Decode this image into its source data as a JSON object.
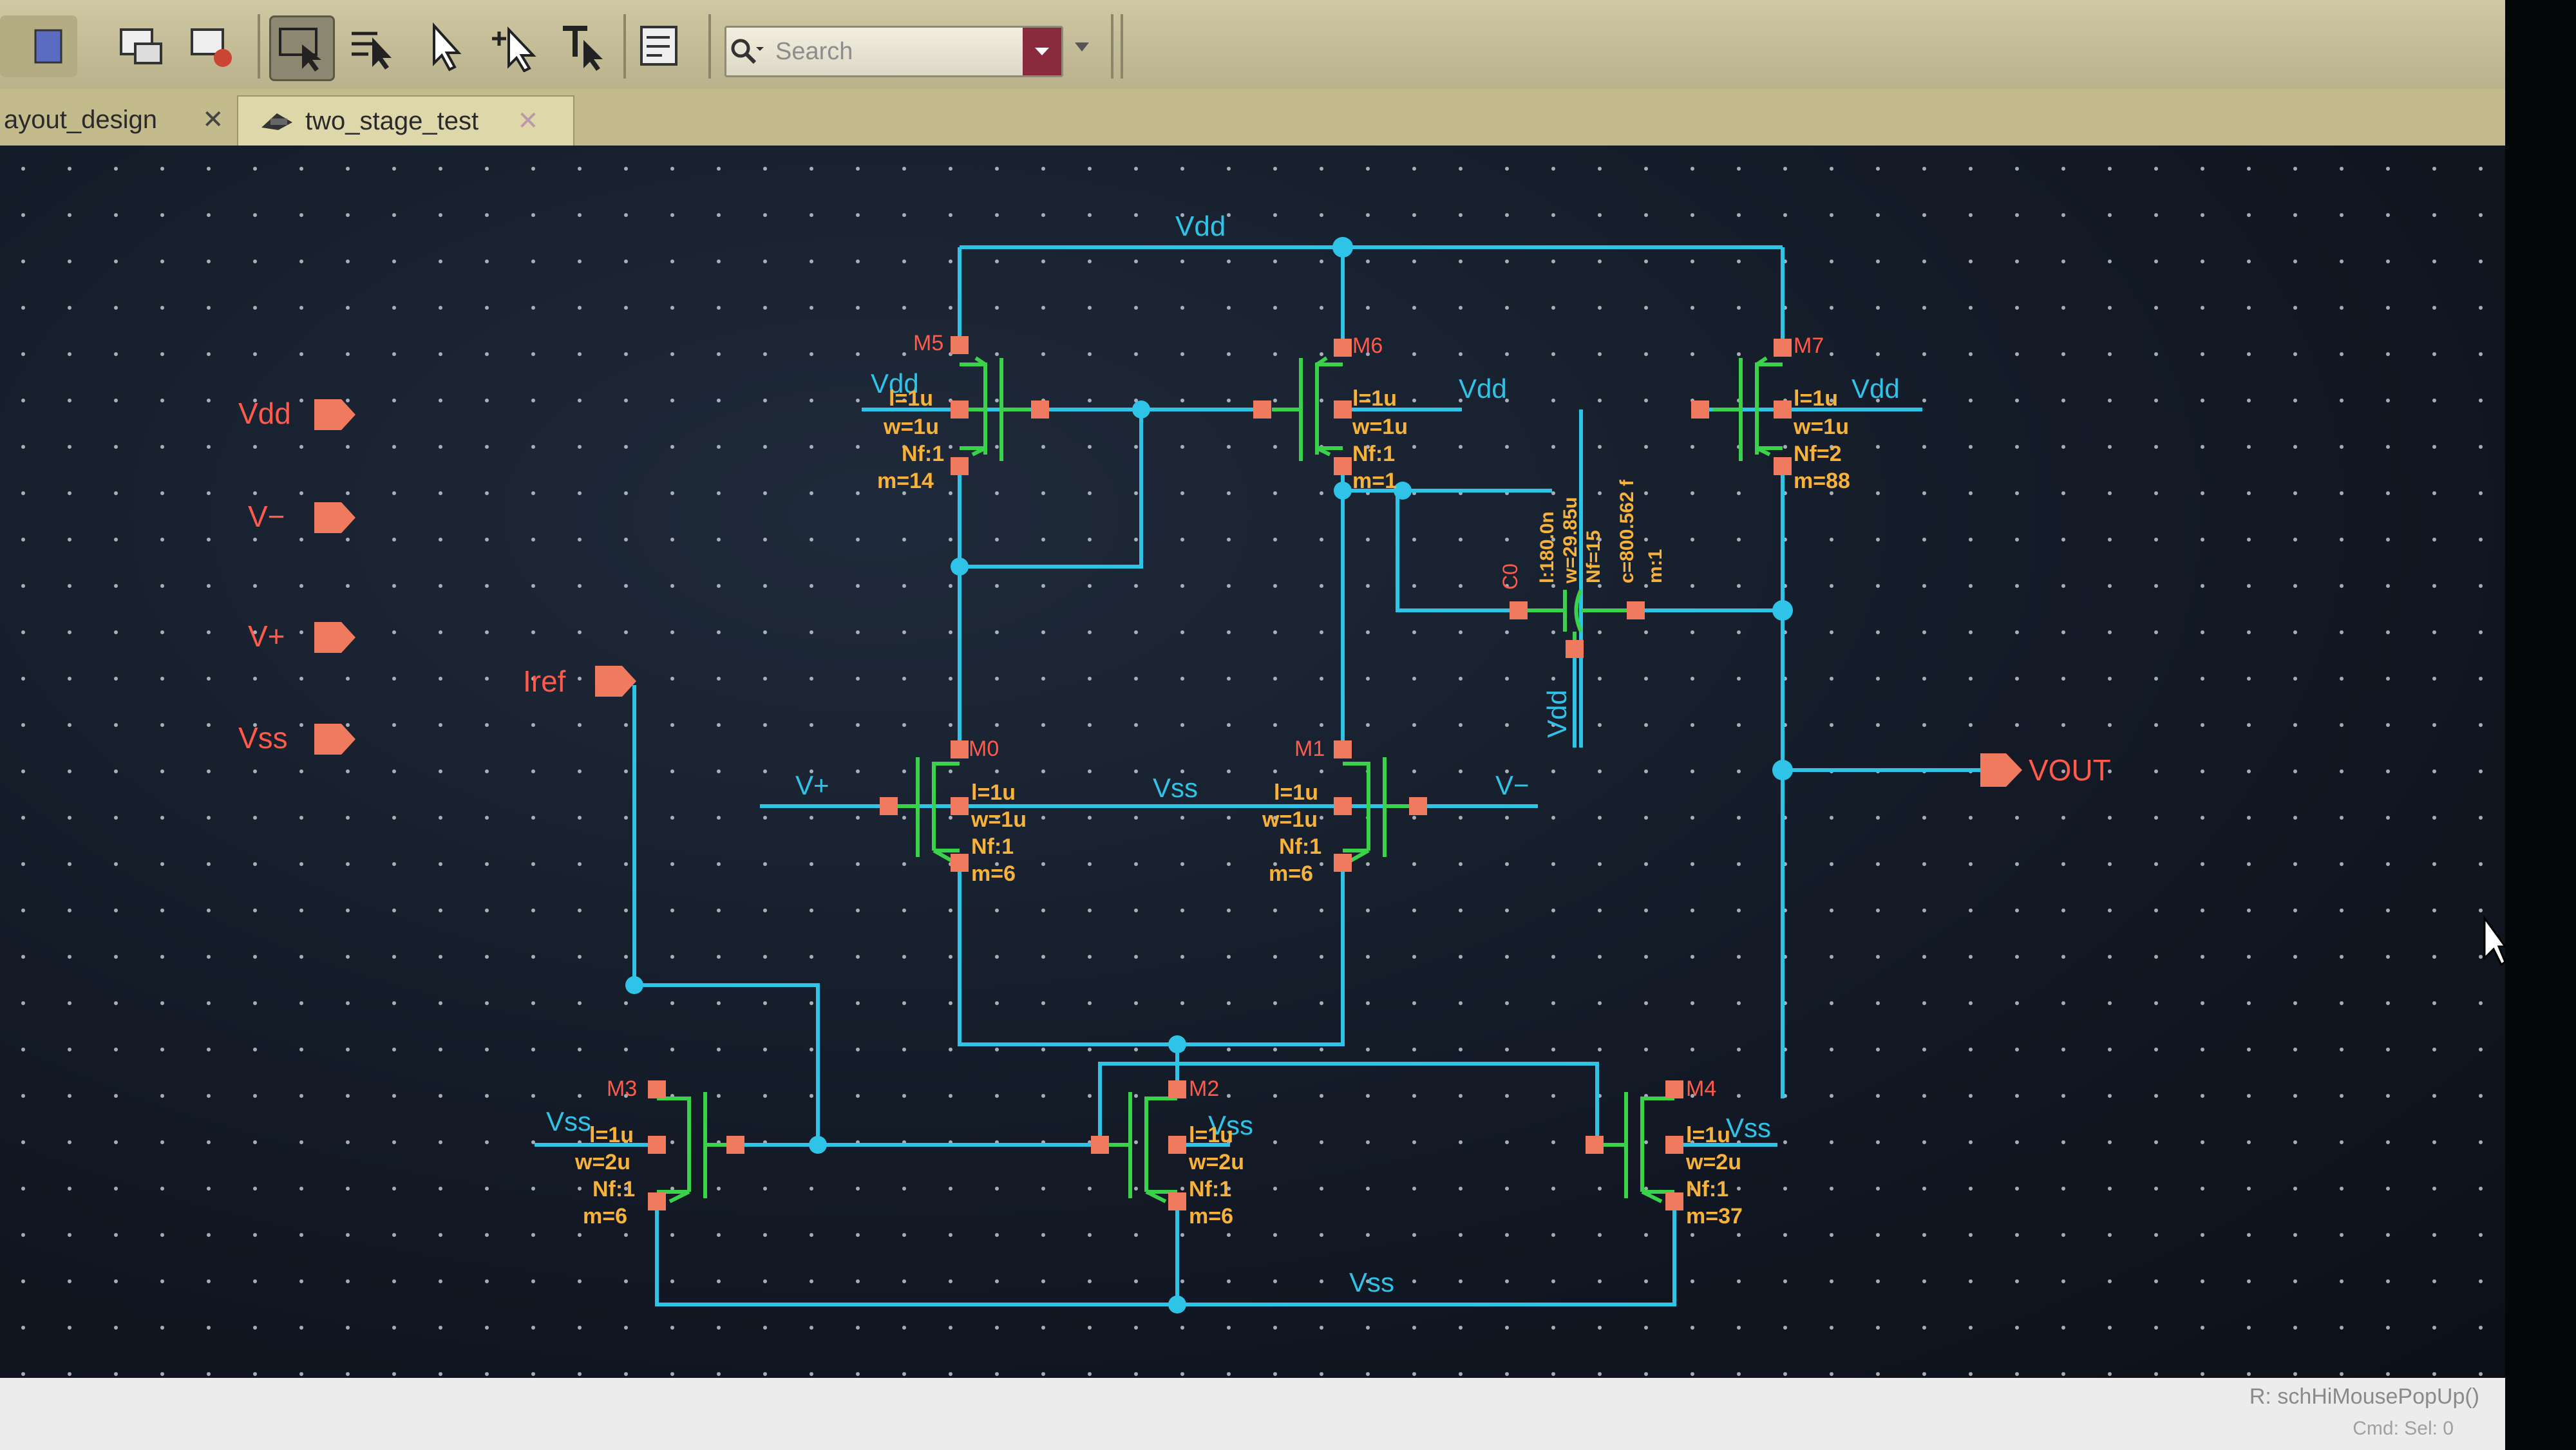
{
  "toolbar": {
    "search_placeholder": "Search",
    "icons": [
      "window-icon",
      "window-zoom-icon",
      "window-delete-icon",
      "select-icon",
      "select-move-icon",
      "pointer-icon",
      "pointer-plus-icon",
      "text-select-icon",
      "property-icon",
      "search-icon"
    ]
  },
  "tabs": [
    {
      "label": "ayout_design",
      "active": false
    },
    {
      "label": "two_stage_test",
      "active": true
    }
  ],
  "pins": {
    "vdd": "Vdd",
    "vminus": "V−",
    "vplus": "V+",
    "vss": "Vss",
    "iref": "Iref",
    "vout": "VOUT"
  },
  "nets": {
    "vdd_top": "Vdd",
    "vdd_m5": "Vdd",
    "vdd_m6": "Vdd",
    "vdd_m7": "Vdd",
    "vdd_cap": "Vdd",
    "vss_mid": "Vss",
    "vss_m3": "Vss",
    "vss_m2": "Vss",
    "vss_m4": "Vss",
    "vss_bottom": "Vss",
    "vplus": "V+",
    "vminus": "V−"
  },
  "devices": {
    "M5": {
      "name": "M5",
      "l": "l=1u",
      "w": "w=1u",
      "nf": "Nf:1",
      "m": "m=14"
    },
    "M6": {
      "name": "M6",
      "l": "l=1u",
      "w": "w=1u",
      "nf": "Nf:1",
      "m": "m=1"
    },
    "M7": {
      "name": "M7",
      "l": "l=1u",
      "w": "w=1u",
      "nf": "Nf=2",
      "m": "m=88"
    },
    "M0": {
      "name": "M0",
      "l": "l=1u",
      "w": "w=1u",
      "nf": "Nf:1",
      "m": "m=6"
    },
    "M1": {
      "name": "M1",
      "l": "l=1u",
      "w": "w=1u",
      "nf": "Nf:1",
      "m": "m=6"
    },
    "M3": {
      "name": "M3",
      "l": "l=1u",
      "w": "w=2u",
      "nf": "Nf:1",
      "m": "m=6"
    },
    "M2": {
      "name": "M2",
      "l": "l=1u",
      "w": "w=2u",
      "nf": "Nf:1",
      "m": "m=6"
    },
    "M4": {
      "name": "M4",
      "l": "l=1u",
      "w": "w=2u",
      "nf": "Nf:1",
      "m": "m=37"
    },
    "C0": {
      "name": "C0",
      "l": "l:180.0n",
      "w": "w=29.85u",
      "nf": "Nf=15",
      "c": "c=800.562 f",
      "m": "m:1"
    }
  },
  "status": {
    "right_text": "R: schHiMousePopUp()",
    "right_small": "Cmd: Sel: 0"
  },
  "colors": {
    "wire": "#2fc3e8",
    "device": "#39d24a",
    "pin": "#f07a5e",
    "label": "#ff5a4a",
    "param": "#f6b23a"
  }
}
